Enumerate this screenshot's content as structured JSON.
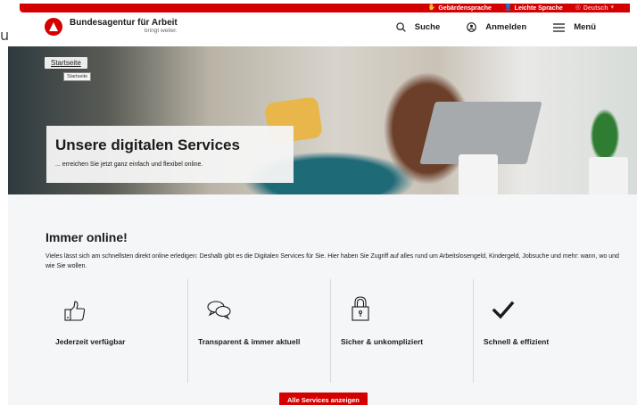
{
  "edge_glyph": "u",
  "topbar": {
    "links": [
      {
        "icon": "sign-language-icon",
        "glyph": "✋",
        "label": "Gebärdensprache"
      },
      {
        "icon": "easy-language-icon",
        "glyph": "👤",
        "label": "Leichte Sprache"
      },
      {
        "icon": "globe-icon",
        "glyph": "◎",
        "label": "Deutsch"
      }
    ]
  },
  "header": {
    "logo_name": "Bundesagentur für Arbeit",
    "logo_claim": "bringt weiter.",
    "nav": {
      "search_label": "Suche",
      "login_label": "Anmelden",
      "menu_label": "Menü"
    }
  },
  "hero": {
    "breadcrumb_label": "Startseite",
    "tooltip_label": "Startseite",
    "title": "Unsere digitalen Services",
    "subtitle": "... erreichen Sie jetzt ganz einfach und flexibel online."
  },
  "main": {
    "title": "Immer online!",
    "body": "Vieles lässt sich am schnellsten direkt online erledigen: Deshalb gibt es die Digitalen Services für Sie. Hier haben Sie Zugriff auf alles rund um Arbeitslosengeld, Kindergeld, Jobsuche und mehr: wann, wo und wie Sie wollen.",
    "features": [
      {
        "icon": "thumbs-up-icon",
        "label": "Jederzeit verfügbar"
      },
      {
        "icon": "chat-bubbles-icon",
        "label": "Transparent & immer aktuell"
      },
      {
        "icon": "lock-icon",
        "label": "Sicher & unkompliziert"
      },
      {
        "icon": "checkmark-icon",
        "label": "Schnell & effizient"
      }
    ],
    "cta_label": "Alle Services anzeigen"
  },
  "colors": {
    "brand_red": "#d40000",
    "text": "#1b1b1b",
    "section_bg": "#f5f6f8"
  }
}
